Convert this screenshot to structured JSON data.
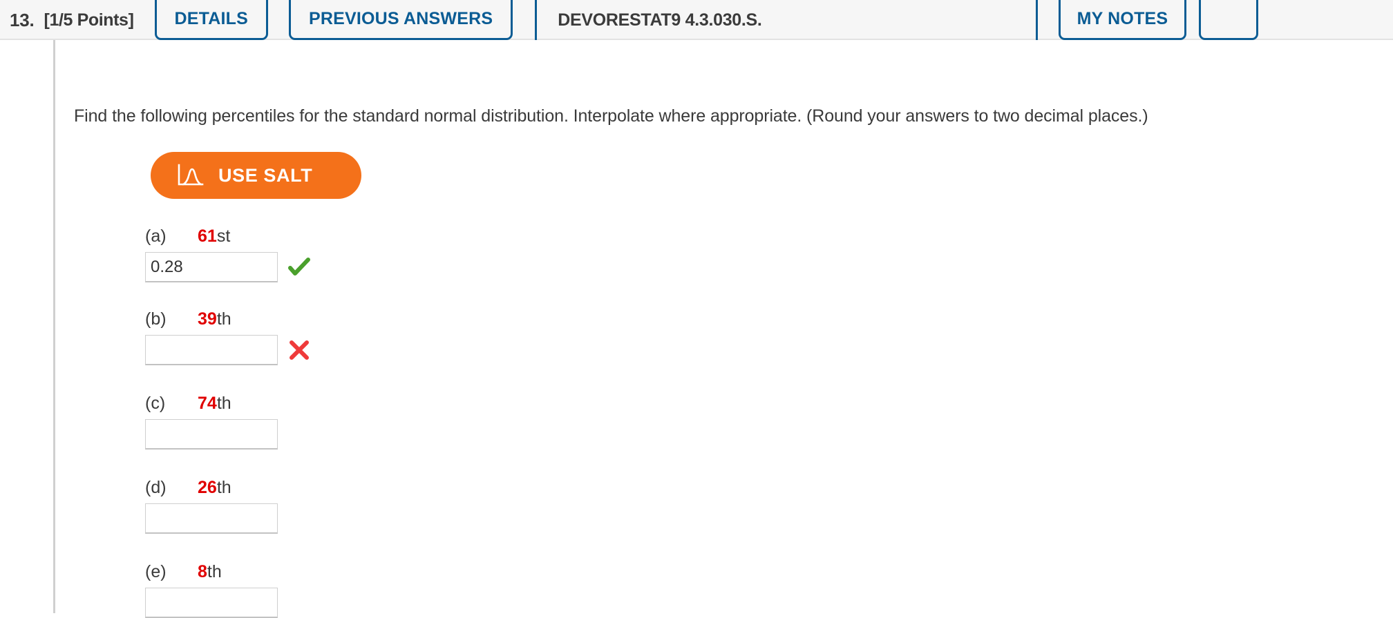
{
  "header": {
    "question_number": "13.",
    "points": "[1/5 Points]",
    "details_label": "DETAILS",
    "previous_answers_label": "PREVIOUS ANSWERS",
    "problem_id": "DEVORESTAT9 4.3.030.S.",
    "my_notes_label": "MY NOTES",
    "clipped_button_label": "",
    "accent_color": "#0b5c94",
    "background_color": "#f6f6f6"
  },
  "question": {
    "prompt": "Find the following percentiles for the standard normal distribution. Interpolate where appropriate. (Round your answers to two decimal places.)"
  },
  "salt": {
    "label": "USE SALT",
    "icon": "normal-distribution-curve-icon",
    "color": "#f4711a"
  },
  "parts": [
    {
      "letter": "(a)",
      "percentile_number": "61",
      "percentile_suffix": "st",
      "value": "0.28",
      "placeholder": "",
      "status": "correct",
      "status_icon": "green-check-icon"
    },
    {
      "letter": "(b)",
      "percentile_number": "39",
      "percentile_suffix": "th",
      "value": "",
      "placeholder": "",
      "status": "incorrect",
      "status_icon": "red-x-icon"
    },
    {
      "letter": "(c)",
      "percentile_number": "74",
      "percentile_suffix": "th",
      "value": "",
      "placeholder": "",
      "status": "none",
      "status_icon": ""
    },
    {
      "letter": "(d)",
      "percentile_number": "26",
      "percentile_suffix": "th",
      "value": "",
      "placeholder": "",
      "status": "none",
      "status_icon": ""
    },
    {
      "letter": "(e)",
      "percentile_number": "8",
      "percentile_suffix": "th",
      "value": "",
      "placeholder": "",
      "status": "none",
      "status_icon": ""
    }
  ],
  "colors": {
    "red_number": "#e00000",
    "text": "#3a3a3a",
    "correct_green": "#4aa02c",
    "incorrect_red": "#ef3a3a"
  }
}
